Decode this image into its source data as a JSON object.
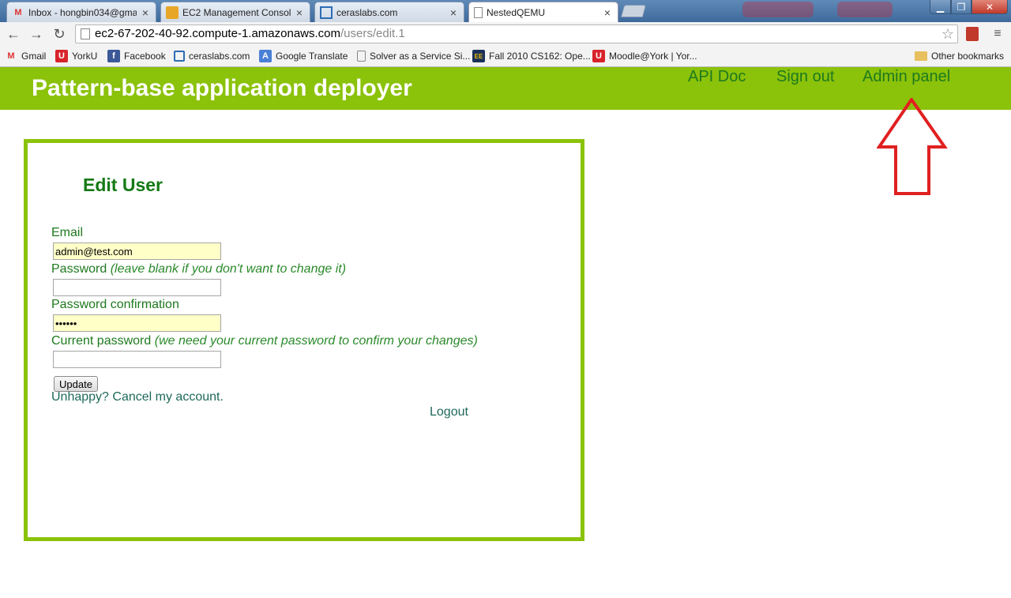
{
  "browser": {
    "tabs": [
      {
        "title": "Inbox - hongbin034@gma",
        "icon": "gmail-icon"
      },
      {
        "title": "EC2 Management Consol",
        "icon": "aws-icon"
      },
      {
        "title": "ceraslabs.com",
        "icon": "ceraslabs-icon"
      },
      {
        "title": "NestedQEMU",
        "icon": "page-icon"
      }
    ],
    "url_host": "ec2-67-202-40-92.compute-1.amazonaws.com",
    "url_path": "/users/edit.1",
    "bookmarks": [
      {
        "label": "Gmail"
      },
      {
        "label": "YorkU"
      },
      {
        "label": "Facebook"
      },
      {
        "label": "ceraslabs.com"
      },
      {
        "label": "Google Translate"
      },
      {
        "label": "Solver as a Service Si..."
      },
      {
        "label": "Fall 2010 CS162: Ope..."
      },
      {
        "label": "Moodle@York | Yor..."
      }
    ],
    "other_bookmarks": "Other bookmarks"
  },
  "header": {
    "title": "Pattern-base application deployer",
    "links": {
      "api_doc": "API Doc",
      "sign_out": "Sign out",
      "admin_panel": "Admin panel"
    }
  },
  "form": {
    "title": "Edit User",
    "email_label": "Email",
    "email_value": "admin@test.com",
    "password_label": "Password",
    "password_hint": "(leave blank if you don't want to change it)",
    "password_confirmation_label": "Password confirmation",
    "password_confirmation_value": "••••••",
    "current_password_label": "Current password",
    "current_password_hint": "(we need your current password to confirm your changes)",
    "update_button": "Update",
    "cancel_link": "Unhappy? Cancel my account.",
    "logout_link": "Logout"
  },
  "colors": {
    "header_green": "#8bc20a",
    "link_green": "#1e7a1e",
    "arrow_red": "#e02020"
  }
}
